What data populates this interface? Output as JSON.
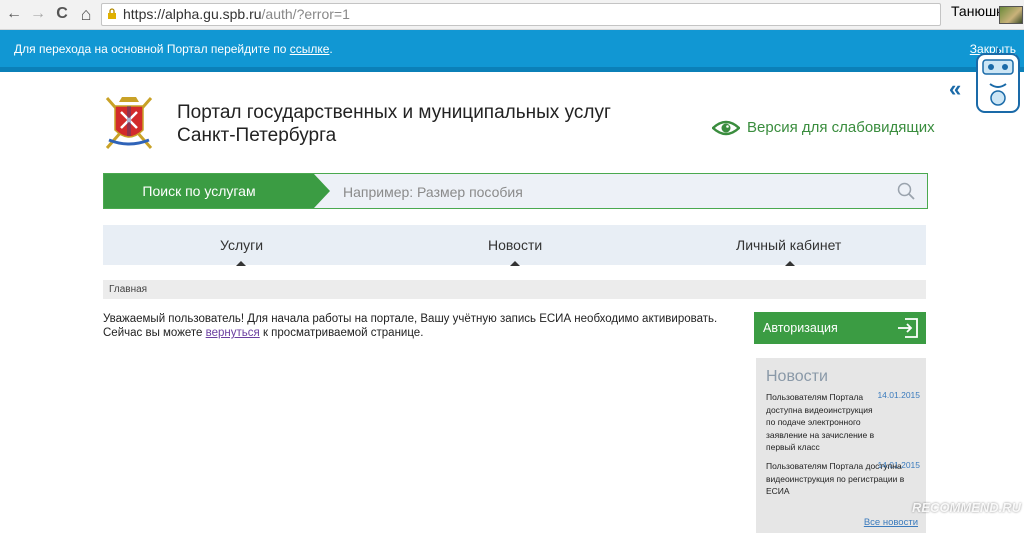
{
  "browser": {
    "back": "←",
    "forward": "→",
    "reload": "C",
    "home": "⌂",
    "url_main": "https://alpha.gu.spb.ru",
    "url_rest": "/auth/?error=1",
    "user": "Танюшк@"
  },
  "notice": {
    "text": "Для перехода на основной Портал перейдите по ",
    "link": "ссылке",
    "dot": ".",
    "close": "Закрыть"
  },
  "header": {
    "title_line1": "Портал государственных и муниципальных услуг",
    "title_line2": "Санкт-Петербурга",
    "low_vision": "Версия для слабовидящих"
  },
  "search": {
    "tab_label": "Поиск по услугам",
    "placeholder": "Например: Размер пособия"
  },
  "nav": {
    "items": [
      {
        "label": "Услуги"
      },
      {
        "label": "Новости"
      },
      {
        "label": "Личный кабинет"
      }
    ]
  },
  "breadcrumb": "Главная",
  "message": {
    "line1": "Уважаемый пользователь! Для начала работы на портале, Вашу учётную запись ЕСИА необходимо активировать.",
    "line2_before": "Сейчас вы можете ",
    "link": "вернуться",
    "line2_after": " к просматриваемой странице."
  },
  "auth": {
    "label": "Авторизация"
  },
  "news": {
    "title": "Новости",
    "items": [
      {
        "date": "14.01.2015",
        "text": "Пользователям Портала доступна видеоинструкция по подаче электронного заявление на зачисление в первый класс"
      },
      {
        "date": "14.01.2015",
        "text": "Пользователям Портала доступна видеоинструкция по регистрации в ЕСИА"
      }
    ],
    "all": "Все новости"
  },
  "side": {
    "chevron": "«"
  },
  "watermark": "RECOMMEND.RU",
  "colors": {
    "notice_blue": "#1197d3",
    "brand_green": "#3b9c43",
    "link_blue": "#3b7bbd",
    "visited_purple": "#6b3fa0"
  }
}
